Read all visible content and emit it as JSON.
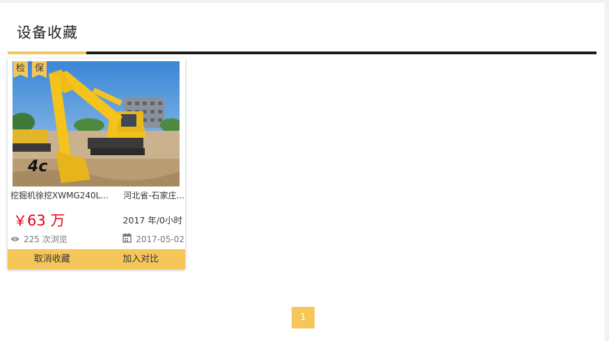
{
  "page": {
    "title": "设备收藏"
  },
  "card": {
    "tags": [
      "检",
      "保"
    ],
    "name": "挖掘机徐挖XWMG240L...",
    "location": "河北省-石家庄...",
    "price_symbol": "￥",
    "price_value": "63",
    "price_unit": "万",
    "year_hours": "2017 年/0小时",
    "views": "225 次浏览",
    "date": "2017-05-02",
    "actions": {
      "cancel": "取消收藏",
      "compare": "加入对比"
    }
  },
  "pagination": {
    "current": "1"
  },
  "colors": {
    "accent": "#f5c65a",
    "price": "#e60012",
    "tab_line": "#1f1a1a"
  },
  "icons": {
    "views": "eye-icon",
    "date": "calendar-icon"
  }
}
